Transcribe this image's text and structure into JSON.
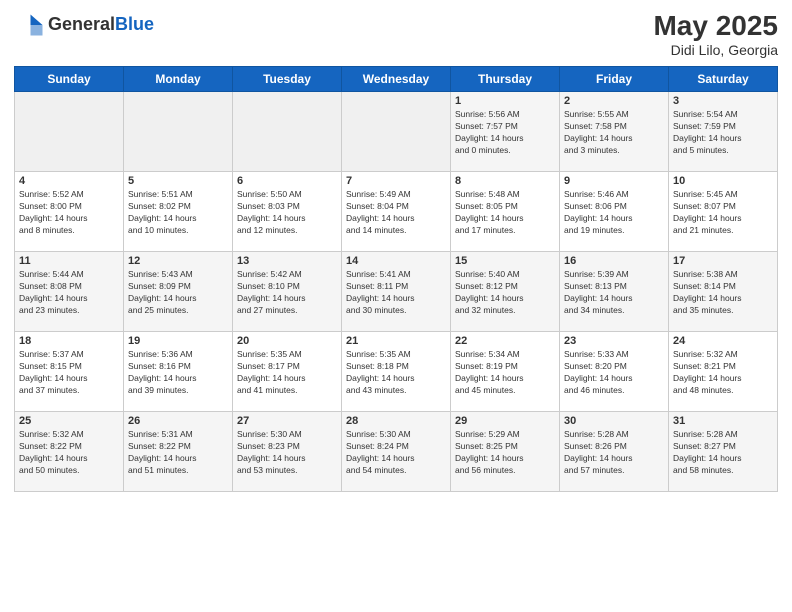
{
  "header": {
    "logo_general": "General",
    "logo_blue": "Blue",
    "month_year": "May 2025",
    "location": "Didi Lilo, Georgia"
  },
  "days_of_week": [
    "Sunday",
    "Monday",
    "Tuesday",
    "Wednesday",
    "Thursday",
    "Friday",
    "Saturday"
  ],
  "weeks": [
    [
      {
        "day": "",
        "info": ""
      },
      {
        "day": "",
        "info": ""
      },
      {
        "day": "",
        "info": ""
      },
      {
        "day": "",
        "info": ""
      },
      {
        "day": "1",
        "info": "Sunrise: 5:56 AM\nSunset: 7:57 PM\nDaylight: 14 hours\nand 0 minutes."
      },
      {
        "day": "2",
        "info": "Sunrise: 5:55 AM\nSunset: 7:58 PM\nDaylight: 14 hours\nand 3 minutes."
      },
      {
        "day": "3",
        "info": "Sunrise: 5:54 AM\nSunset: 7:59 PM\nDaylight: 14 hours\nand 5 minutes."
      }
    ],
    [
      {
        "day": "4",
        "info": "Sunrise: 5:52 AM\nSunset: 8:00 PM\nDaylight: 14 hours\nand 8 minutes."
      },
      {
        "day": "5",
        "info": "Sunrise: 5:51 AM\nSunset: 8:02 PM\nDaylight: 14 hours\nand 10 minutes."
      },
      {
        "day": "6",
        "info": "Sunrise: 5:50 AM\nSunset: 8:03 PM\nDaylight: 14 hours\nand 12 minutes."
      },
      {
        "day": "7",
        "info": "Sunrise: 5:49 AM\nSunset: 8:04 PM\nDaylight: 14 hours\nand 14 minutes."
      },
      {
        "day": "8",
        "info": "Sunrise: 5:48 AM\nSunset: 8:05 PM\nDaylight: 14 hours\nand 17 minutes."
      },
      {
        "day": "9",
        "info": "Sunrise: 5:46 AM\nSunset: 8:06 PM\nDaylight: 14 hours\nand 19 minutes."
      },
      {
        "day": "10",
        "info": "Sunrise: 5:45 AM\nSunset: 8:07 PM\nDaylight: 14 hours\nand 21 minutes."
      }
    ],
    [
      {
        "day": "11",
        "info": "Sunrise: 5:44 AM\nSunset: 8:08 PM\nDaylight: 14 hours\nand 23 minutes."
      },
      {
        "day": "12",
        "info": "Sunrise: 5:43 AM\nSunset: 8:09 PM\nDaylight: 14 hours\nand 25 minutes."
      },
      {
        "day": "13",
        "info": "Sunrise: 5:42 AM\nSunset: 8:10 PM\nDaylight: 14 hours\nand 27 minutes."
      },
      {
        "day": "14",
        "info": "Sunrise: 5:41 AM\nSunset: 8:11 PM\nDaylight: 14 hours\nand 30 minutes."
      },
      {
        "day": "15",
        "info": "Sunrise: 5:40 AM\nSunset: 8:12 PM\nDaylight: 14 hours\nand 32 minutes."
      },
      {
        "day": "16",
        "info": "Sunrise: 5:39 AM\nSunset: 8:13 PM\nDaylight: 14 hours\nand 34 minutes."
      },
      {
        "day": "17",
        "info": "Sunrise: 5:38 AM\nSunset: 8:14 PM\nDaylight: 14 hours\nand 35 minutes."
      }
    ],
    [
      {
        "day": "18",
        "info": "Sunrise: 5:37 AM\nSunset: 8:15 PM\nDaylight: 14 hours\nand 37 minutes."
      },
      {
        "day": "19",
        "info": "Sunrise: 5:36 AM\nSunset: 8:16 PM\nDaylight: 14 hours\nand 39 minutes."
      },
      {
        "day": "20",
        "info": "Sunrise: 5:35 AM\nSunset: 8:17 PM\nDaylight: 14 hours\nand 41 minutes."
      },
      {
        "day": "21",
        "info": "Sunrise: 5:35 AM\nSunset: 8:18 PM\nDaylight: 14 hours\nand 43 minutes."
      },
      {
        "day": "22",
        "info": "Sunrise: 5:34 AM\nSunset: 8:19 PM\nDaylight: 14 hours\nand 45 minutes."
      },
      {
        "day": "23",
        "info": "Sunrise: 5:33 AM\nSunset: 8:20 PM\nDaylight: 14 hours\nand 46 minutes."
      },
      {
        "day": "24",
        "info": "Sunrise: 5:32 AM\nSunset: 8:21 PM\nDaylight: 14 hours\nand 48 minutes."
      }
    ],
    [
      {
        "day": "25",
        "info": "Sunrise: 5:32 AM\nSunset: 8:22 PM\nDaylight: 14 hours\nand 50 minutes."
      },
      {
        "day": "26",
        "info": "Sunrise: 5:31 AM\nSunset: 8:22 PM\nDaylight: 14 hours\nand 51 minutes."
      },
      {
        "day": "27",
        "info": "Sunrise: 5:30 AM\nSunset: 8:23 PM\nDaylight: 14 hours\nand 53 minutes."
      },
      {
        "day": "28",
        "info": "Sunrise: 5:30 AM\nSunset: 8:24 PM\nDaylight: 14 hours\nand 54 minutes."
      },
      {
        "day": "29",
        "info": "Sunrise: 5:29 AM\nSunset: 8:25 PM\nDaylight: 14 hours\nand 56 minutes."
      },
      {
        "day": "30",
        "info": "Sunrise: 5:28 AM\nSunset: 8:26 PM\nDaylight: 14 hours\nand 57 minutes."
      },
      {
        "day": "31",
        "info": "Sunrise: 5:28 AM\nSunset: 8:27 PM\nDaylight: 14 hours\nand 58 minutes."
      }
    ]
  ]
}
